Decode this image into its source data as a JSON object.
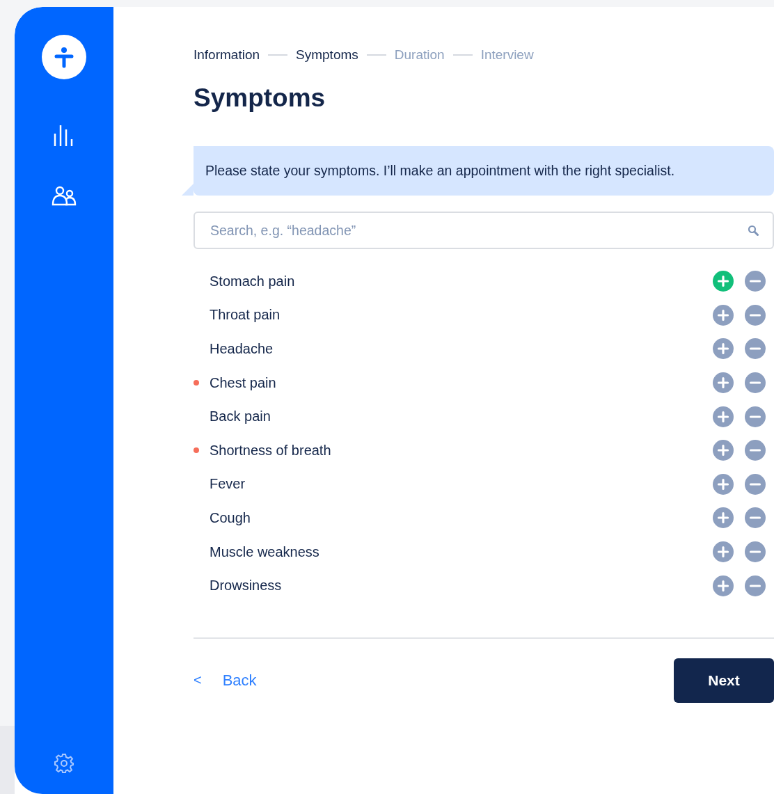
{
  "steps": [
    {
      "label": "Information",
      "reached": true
    },
    {
      "label": "Symptoms",
      "reached": true
    },
    {
      "label": "Duration",
      "reached": false
    },
    {
      "label": "Interview",
      "reached": false
    }
  ],
  "title": "Symptoms",
  "message": "Please state your symptoms. I’ll make an appointment with the right specialist.",
  "search": {
    "placeholder": "Search, e.g. “headache”"
  },
  "symptoms": [
    {
      "name": "Stomach pain",
      "flagged": false,
      "added": true
    },
    {
      "name": "Throat pain",
      "flagged": false,
      "added": false
    },
    {
      "name": "Headache",
      "flagged": false,
      "added": false
    },
    {
      "name": "Chest pain",
      "flagged": true,
      "added": false
    },
    {
      "name": "Back pain",
      "flagged": false,
      "added": false
    },
    {
      "name": "Shortness of breath",
      "flagged": true,
      "added": false
    },
    {
      "name": "Fever",
      "flagged": false,
      "added": false
    },
    {
      "name": "Cough",
      "flagged": false,
      "added": false
    },
    {
      "name": "Muscle weakness",
      "flagged": false,
      "added": false
    },
    {
      "name": "Drowsiness",
      "flagged": false,
      "added": false
    }
  ],
  "back_button": {
    "icon": "<",
    "label": "Back"
  },
  "next_button": {
    "label": "Next"
  }
}
